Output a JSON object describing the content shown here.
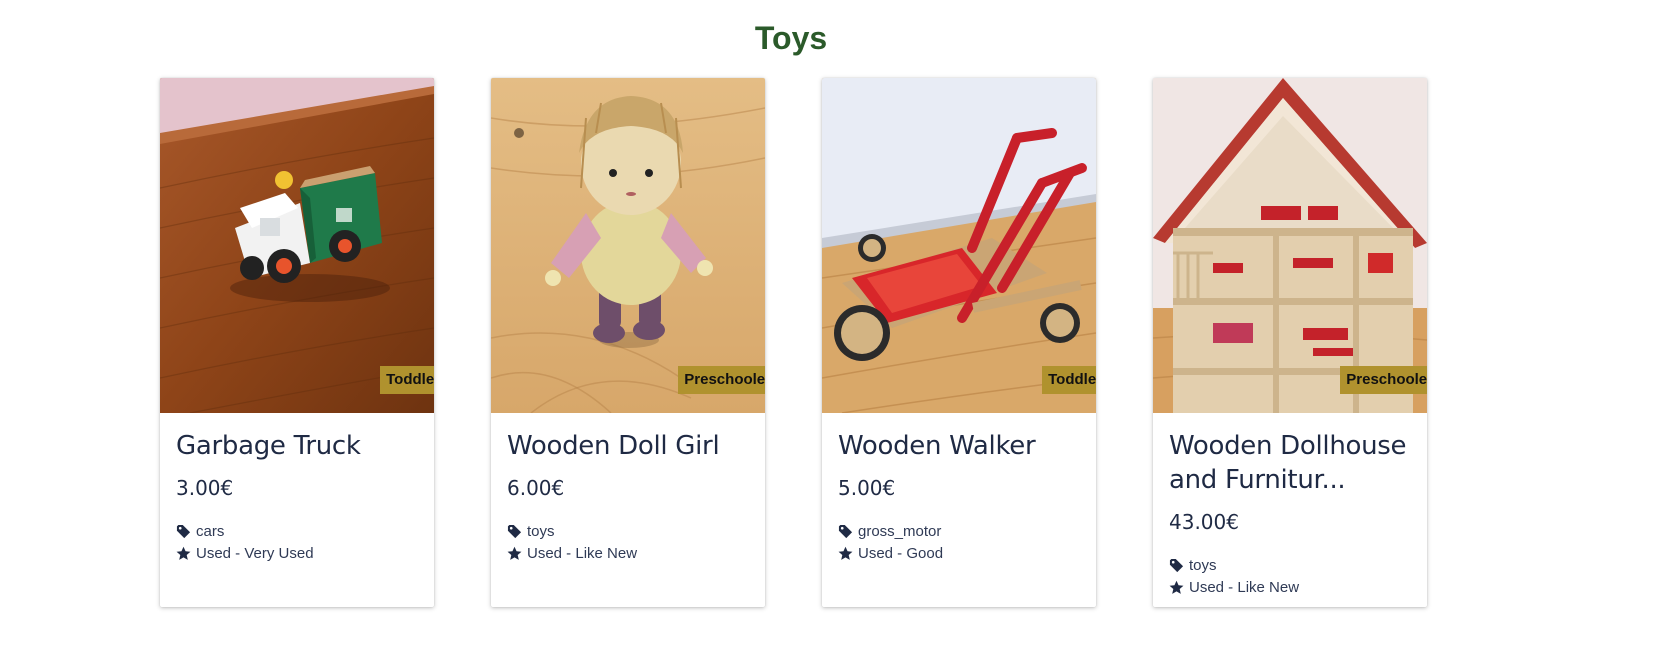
{
  "section": {
    "title": "Toys"
  },
  "products": [
    {
      "title": "Garbage Truck",
      "price": "3.00€",
      "age_badge": "Toddler",
      "tag": "cars",
      "condition": "Used - Very Used",
      "image_icon": "toy-truck-photo"
    },
    {
      "title": "Wooden Doll Girl",
      "price": "6.00€",
      "age_badge": "Preschooler",
      "tag": "toys",
      "condition": "Used - Like New",
      "image_icon": "doll-photo"
    },
    {
      "title": "Wooden Walker",
      "price": "5.00€",
      "age_badge": "Toddler",
      "tag": "gross_motor",
      "condition": "Used - Good",
      "image_icon": "walker-photo"
    },
    {
      "title": "Wooden Dollhouse and Furnitur...",
      "price": "43.00€",
      "age_badge": "Preschooler",
      "tag": "toys",
      "condition": "Used - Like New",
      "image_icon": "dollhouse-photo"
    }
  ],
  "icons": {
    "tag": "tag-icon",
    "condition": "star-icon"
  },
  "colors": {
    "title": "#2b5a2a",
    "badge": "#b0922e",
    "text": "#1f2a44"
  }
}
